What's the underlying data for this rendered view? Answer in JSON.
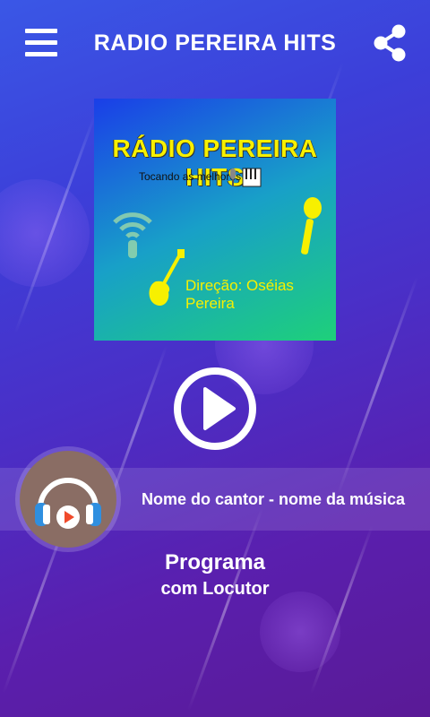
{
  "header": {
    "title": "RADIO PEREIRA HITS",
    "menu_icon": "hamburger-menu-icon",
    "share_icon": "share-icon"
  },
  "logo": {
    "title": "RÁDIO PEREIRA HITS",
    "subtitle": "Tocando as melhores",
    "direction": "Direção: Oséias Pereira",
    "colors": {
      "title": "#f7f000",
      "bg_start": "#1a3ee8",
      "bg_end": "#1ed07a"
    }
  },
  "player": {
    "play_icon": "play-icon",
    "now_playing": "Nome do cantor - nome da música",
    "avatar_icon": "headphones-play-icon"
  },
  "program": {
    "title": "Programa",
    "subtitle": "com Locutor"
  },
  "theme": {
    "bg_top": "#3a57e6",
    "bg_bottom": "#5a1a96",
    "avatar_color": "#8a6d64"
  }
}
